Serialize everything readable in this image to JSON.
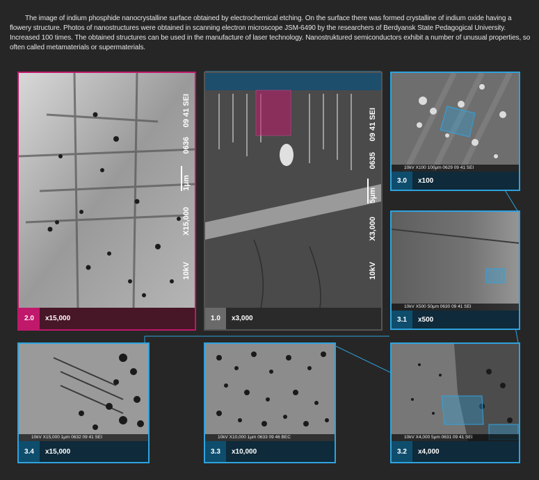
{
  "intro_text": "The image of indium phosphide nanocrystalline surface obtained by electrochemical etching. On the surface there was formed crystalline of indium oxide having a flowery structure. Photos of nanostructures were obtained in scanning electron microscope JSM-6490 by the researchers of Berdyansk State Pedagogical University. Increased 100 times. The obtained structures can be used in the manufacture of laser technology. Nanostruktured semiconductors exhibit a number of unusual properties, so often called metamaterials or supermaterials.",
  "panels": {
    "p20": {
      "num": "2.0",
      "mag": "x15,000",
      "v_kv": "10kV",
      "v_mag": "X15,000",
      "v_scale": "1μm",
      "v_id": "0636",
      "v_time": "09 41 SEI"
    },
    "p10": {
      "num": "1.0",
      "mag": "x3,000",
      "v_kv": "10kV",
      "v_mag": "X3,000",
      "v_scale": "5μm",
      "v_id": "0635",
      "v_time": "09 41 SEI"
    },
    "p30": {
      "num": "3.0",
      "mag": "x100",
      "databar": "10kV   X100   100μm   0629   09 41 SEI"
    },
    "p31": {
      "num": "3.1",
      "mag": "x500",
      "databar": "10kV   X500   50μm   0630   09 41 SEI"
    },
    "p34": {
      "num": "3.4",
      "mag": "x15,000",
      "databar": "10kV   X15,000   1μm   0632   09 41 SEI"
    },
    "p33": {
      "num": "3.3",
      "mag": "x10,000",
      "databar": "10kV   X10,000   1μm   0633   09 46 BEC"
    },
    "p32": {
      "num": "3.2",
      "mag": "x4,000",
      "databar": "10kV   X4,000   5μm   0631   09 41 SEI"
    }
  },
  "colors": {
    "background": "#262626",
    "accent_blue": "#2fa3de",
    "accent_pink": "#c0186b",
    "caption_blue": "#0f2a3a",
    "caption_pink": "#471627"
  }
}
